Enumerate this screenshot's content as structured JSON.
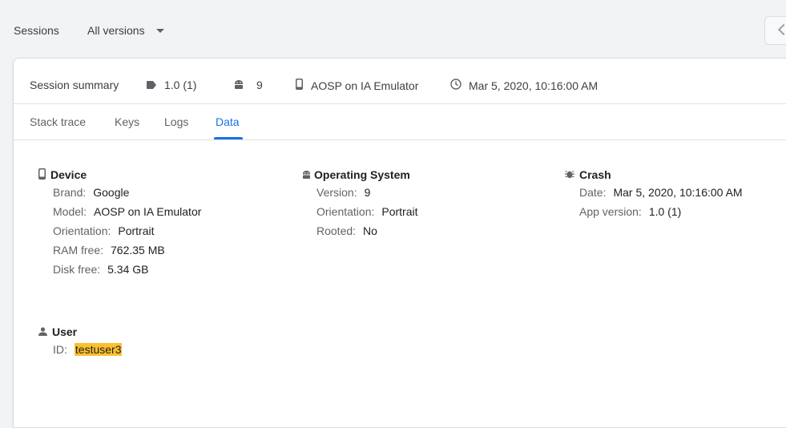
{
  "topbar": {
    "sessions_label": "Sessions",
    "versions_select": "All versions"
  },
  "summary": {
    "title": "Session summary",
    "version": "1.0 (1)",
    "api_level": "9",
    "device": "AOSP on IA Emulator",
    "datetime": "Mar 5, 2020, 10:16:00 AM"
  },
  "tabs": [
    {
      "label": "Stack trace",
      "active": false
    },
    {
      "label": "Keys",
      "active": false
    },
    {
      "label": "Logs",
      "active": false
    },
    {
      "label": "Data",
      "active": true
    }
  ],
  "device": {
    "title": "Device",
    "rows": [
      {
        "key": "Brand:",
        "value": "Google"
      },
      {
        "key": "Model:",
        "value": "AOSP on IA Emulator"
      },
      {
        "key": "Orientation:",
        "value": "Portrait"
      },
      {
        "key": "RAM free:",
        "value": "762.35 MB"
      },
      {
        "key": "Disk free:",
        "value": "5.34 GB"
      }
    ]
  },
  "os": {
    "title": "Operating System",
    "rows": [
      {
        "key": "Version:",
        "value": "9"
      },
      {
        "key": "Orientation:",
        "value": "Portrait"
      },
      {
        "key": "Rooted:",
        "value": "No"
      }
    ]
  },
  "crash": {
    "title": "Crash",
    "rows": [
      {
        "key": "Date:",
        "value": "Mar 5, 2020, 10:16:00 AM"
      },
      {
        "key": "App version:",
        "value": "1.0 (1)"
      }
    ]
  },
  "user": {
    "title": "User",
    "id_key": "ID:",
    "id_value": "testuser3"
  },
  "colors": {
    "accent": "#1a73e8",
    "highlight": "#fbc02d"
  }
}
